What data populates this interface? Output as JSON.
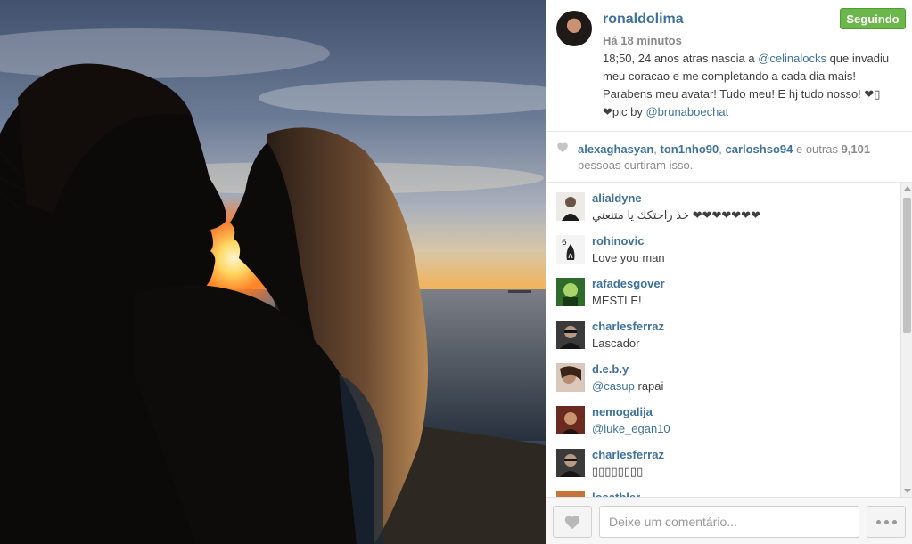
{
  "post": {
    "username": "ronaldolima",
    "follow_label": "Seguindo",
    "timestamp": "Há 18 minutos",
    "caption_lines": [
      {
        "pre": "18;50, 24 anos atras nascia a ",
        "mention": "@celinalocks",
        "post": " que invadiu"
      },
      {
        "pre": "meu coracao e me completando a cada dia mais!",
        "mention": "",
        "post": ""
      },
      {
        "pre": "Parabens meu avatar! Tudo meu! E hj tudo nosso! ❤▯",
        "mention": "",
        "post": ""
      },
      {
        "pre": "❤pic by ",
        "mention": "@brunaboechat",
        "post": ""
      }
    ]
  },
  "likes": {
    "user1": "alexaghasyan",
    "sep1": ", ",
    "user2": "ton1nho90",
    "sep2": ", ",
    "user3": "carloshso94",
    "middle": " e outras ",
    "count": "9,101",
    "suffix": "pessoas curtiram isso."
  },
  "comments": [
    {
      "name": "alialdyne",
      "text": "خذ راحتكك يا متنعني ❤❤❤❤❤❤❤",
      "avatar_color": "#e9e6e2"
    },
    {
      "name": "rohinovic",
      "text": "Love you man",
      "avatar_color": "#f3f3f3"
    },
    {
      "name": "rafadesgover",
      "text": "MESTLE!",
      "avatar_color": "#2b5d2a"
    },
    {
      "name": "charlesferraz",
      "text": "Lascador",
      "avatar_color": "#2a2a2a"
    },
    {
      "name": "d.e.b.y",
      "text_mention": "@casup",
      "text_post": " rapai",
      "avatar_color": "#8a6d5a"
    },
    {
      "name": "nemogalija",
      "text_mention": "@luke_egan10",
      "text_post": "",
      "avatar_color": "#5b3d2a"
    },
    {
      "name": "charlesferraz",
      "text": "▯▯▯▯▯▯▯▯",
      "avatar_color": "#2a2a2a"
    },
    {
      "name": "losatbler",
      "text": "",
      "avatar_color": "#c4743a"
    }
  ],
  "footer": {
    "comment_placeholder": "Deixe um comentário..."
  },
  "icons": {
    "like": "heart-icon",
    "more": "ellipsis-icon",
    "likes_heart": "heart-icon"
  },
  "colors": {
    "link": "#3f729b",
    "follow_button": "#6bb74b",
    "muted": "#8a8a8a"
  }
}
